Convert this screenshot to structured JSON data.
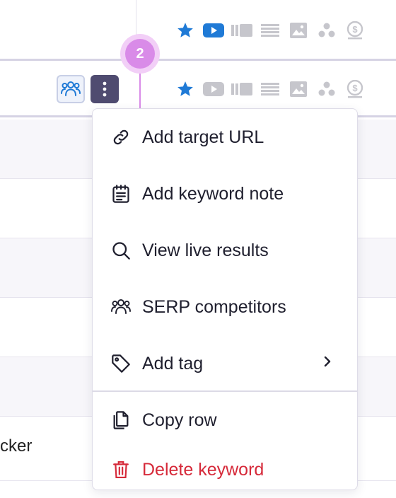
{
  "row_icons": [
    "star-icon",
    "youtube-icon",
    "video-carousel-icon",
    "list-icon",
    "image-icon",
    "local-pack-icon",
    "ads-dollar-icon"
  ],
  "step_badge": "2",
  "background_text": "cker",
  "context_menu": {
    "items": [
      {
        "label": "Add target URL",
        "icon": "link-icon"
      },
      {
        "label": "Add keyword note",
        "icon": "note-icon"
      },
      {
        "label": "View live results",
        "icon": "search-icon"
      },
      {
        "label": "SERP competitors",
        "icon": "users-icon"
      },
      {
        "label": "Add tag",
        "icon": "tag-icon",
        "has_submenu": true
      },
      {
        "label": "Copy row",
        "icon": "copy-icon"
      },
      {
        "label": "Delete keyword",
        "icon": "trash-icon",
        "danger": true
      }
    ]
  },
  "colors": {
    "accent_blue": "#1f7ad6",
    "muted_icon": "#c6c6cc",
    "more_button": "#4f4b70",
    "step_badge": "#d98be8",
    "danger": "#d62a3a"
  }
}
